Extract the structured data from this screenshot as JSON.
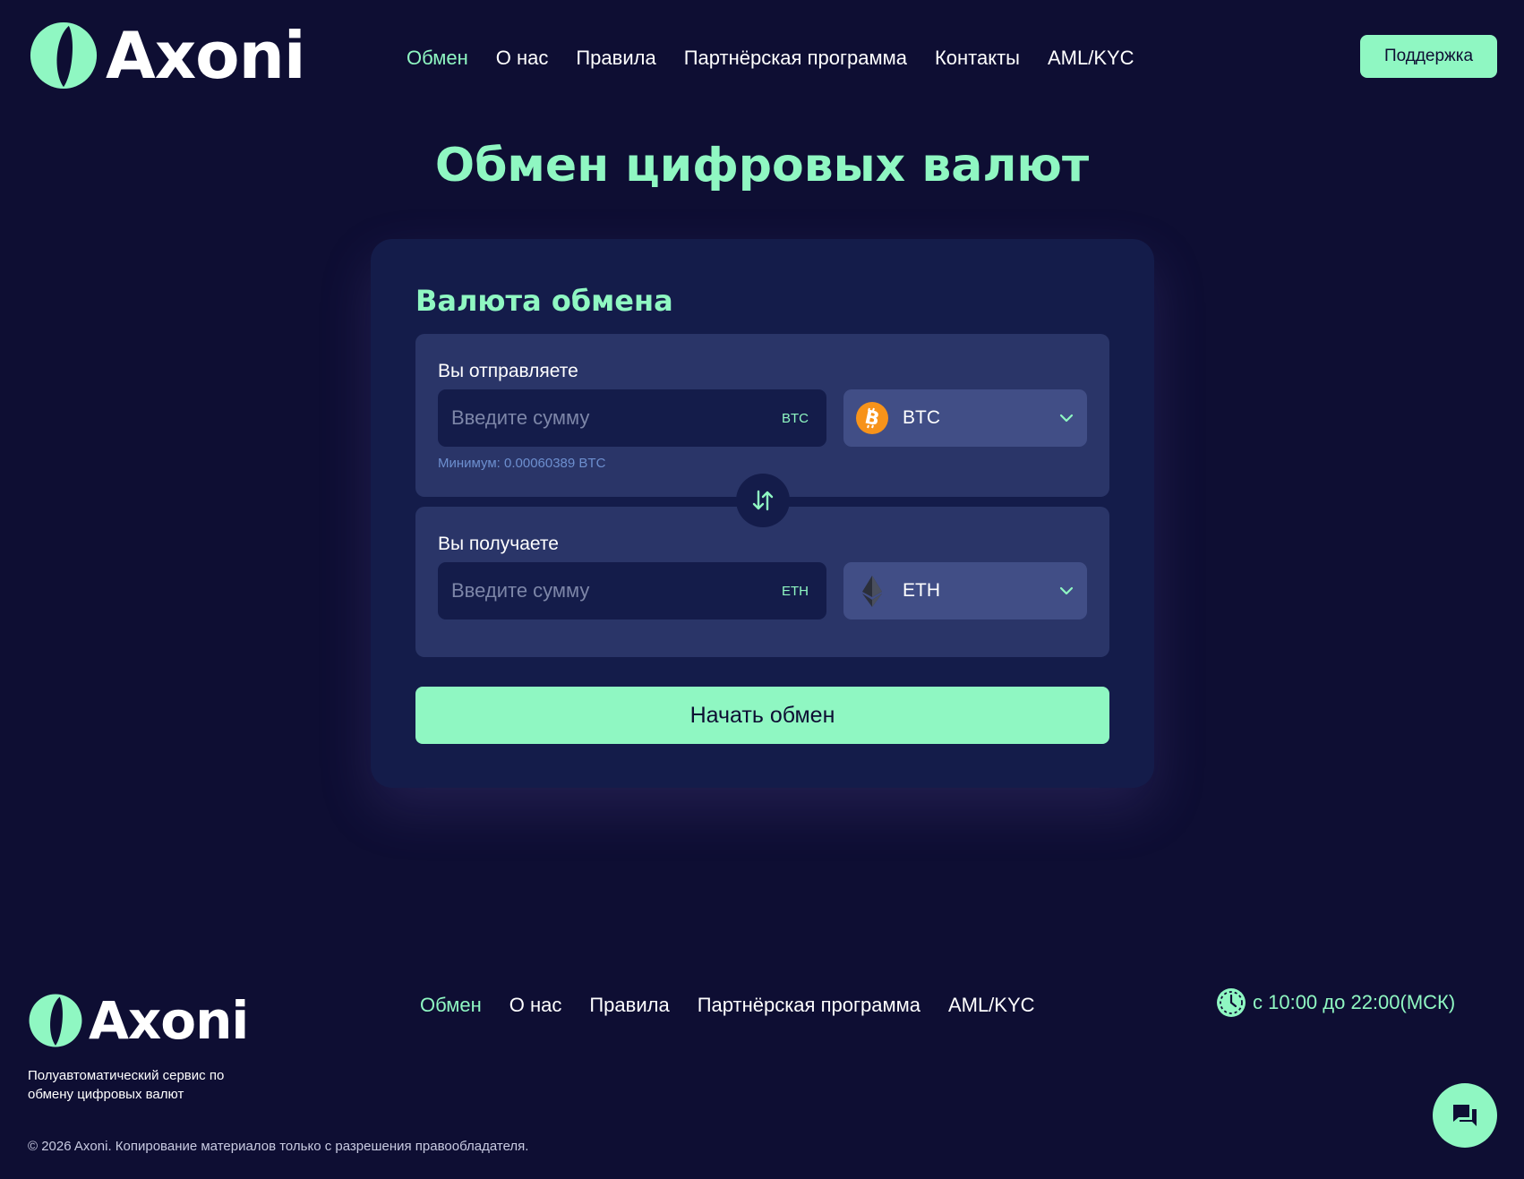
{
  "header": {
    "logo_text": "Axoni",
    "nav": [
      {
        "label": "Обмен",
        "active": true
      },
      {
        "label": "О нас"
      },
      {
        "label": "Правила"
      },
      {
        "label": "Партнёрская программа"
      },
      {
        "label": "Контакты"
      },
      {
        "label": "AML/KYC"
      }
    ],
    "support_label": "Поддержка"
  },
  "page_title": "Обмен цифровых валют",
  "exchange": {
    "title": "Валюта обмена",
    "send": {
      "label": "Вы отправляете",
      "placeholder": "Введите сумму",
      "unit": "BTC",
      "currency": "BTC",
      "currency_icon": "bitcoin-icon",
      "minimum": "Минимум: 0.00060389 BTC"
    },
    "receive": {
      "label": "Вы получаете",
      "placeholder": "Введите сумму",
      "unit": "ETH",
      "currency": "ETH",
      "currency_icon": "ethereum-icon"
    },
    "swap_icon": "swap-arrows-icon",
    "start_label": "Начать обмен"
  },
  "footer": {
    "logo_text": "Axoni",
    "tagline": "Полуавтоматический сервис по обмену цифровых валют",
    "nav": [
      {
        "label": "Обмен",
        "active": true
      },
      {
        "label": "О нас"
      },
      {
        "label": "Правила"
      },
      {
        "label": "Партнёрская программа"
      },
      {
        "label": "AML/KYC"
      }
    ],
    "hours": "с 10:00 до 22:00(МСК)",
    "copyright": "© 2026 Axoni. Копирование материалов только с разрешения правообладателя.",
    "chat_icon": "chat-icon"
  },
  "colors": {
    "background": "#0e0e33",
    "accent": "#8ff7c2",
    "card": "#141c4a",
    "panel": "#2a3568",
    "select": "#414e86",
    "bitcoin": "#f7931a"
  }
}
